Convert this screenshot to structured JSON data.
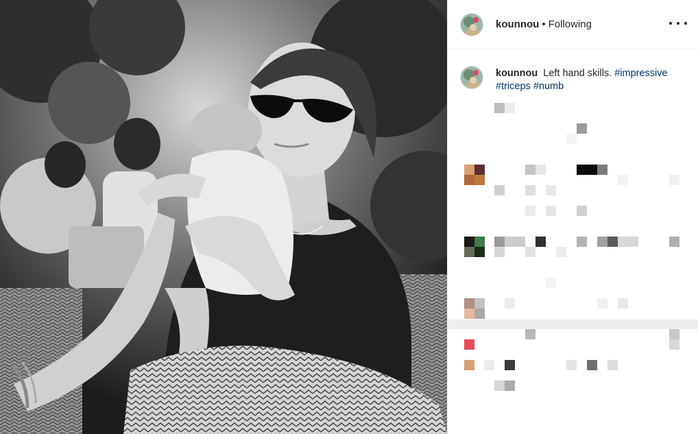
{
  "post": {
    "header": {
      "username": "kounnou",
      "separator": "•",
      "follow_status": "Following",
      "more_icon": "more-horizontal-icon"
    },
    "caption": {
      "username": "kounnou",
      "text": "Left hand skills.",
      "hashtags": [
        "#impressive",
        "#triceps",
        "#numb"
      ]
    },
    "photo": {
      "icon": "photo-black-and-white"
    },
    "comments_blurred": true
  }
}
